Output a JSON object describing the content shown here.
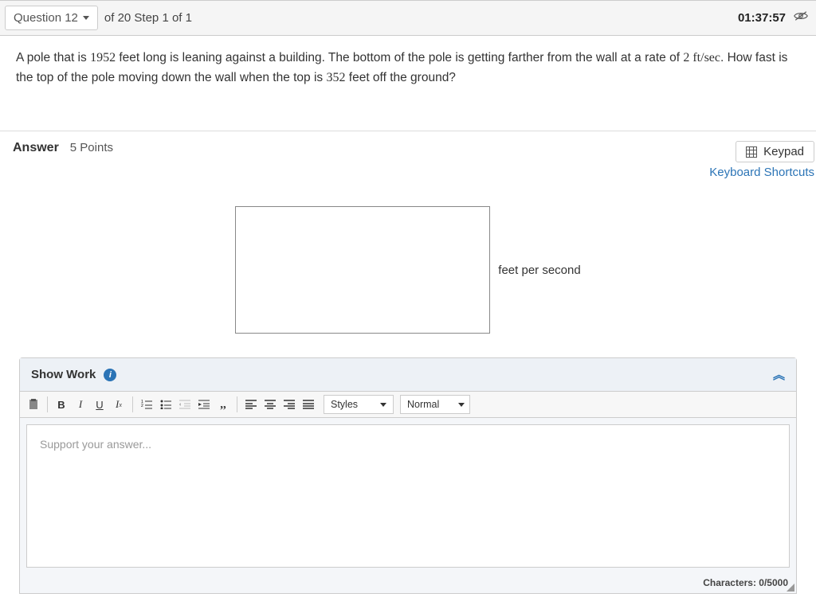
{
  "header": {
    "question_label": "Question 12",
    "step_info": "of 20 Step 1 of 1",
    "timer": "01:37:57"
  },
  "question": {
    "t1": "A pole that is ",
    "v1": "1952",
    "t2": " feet long is leaning against a building. The bottom of the pole is getting farther from the wall at a rate of ",
    "v2": "2 ft/sec",
    "t3": ". How fast is the top of the pole moving down the wall when the top is ",
    "v3": "352",
    "t4": " feet off the ground?"
  },
  "answer": {
    "label": "Answer",
    "points": "5 Points",
    "keypad": "Keypad",
    "shortcuts": "Keyboard Shortcuts",
    "unit": "feet per second",
    "input_value": ""
  },
  "showwork": {
    "title": "Show Work",
    "styles_dd": "Styles",
    "format_dd": "Normal",
    "placeholder": "Support your answer...",
    "char_label": "Characters: ",
    "char_count": "0/5000"
  }
}
